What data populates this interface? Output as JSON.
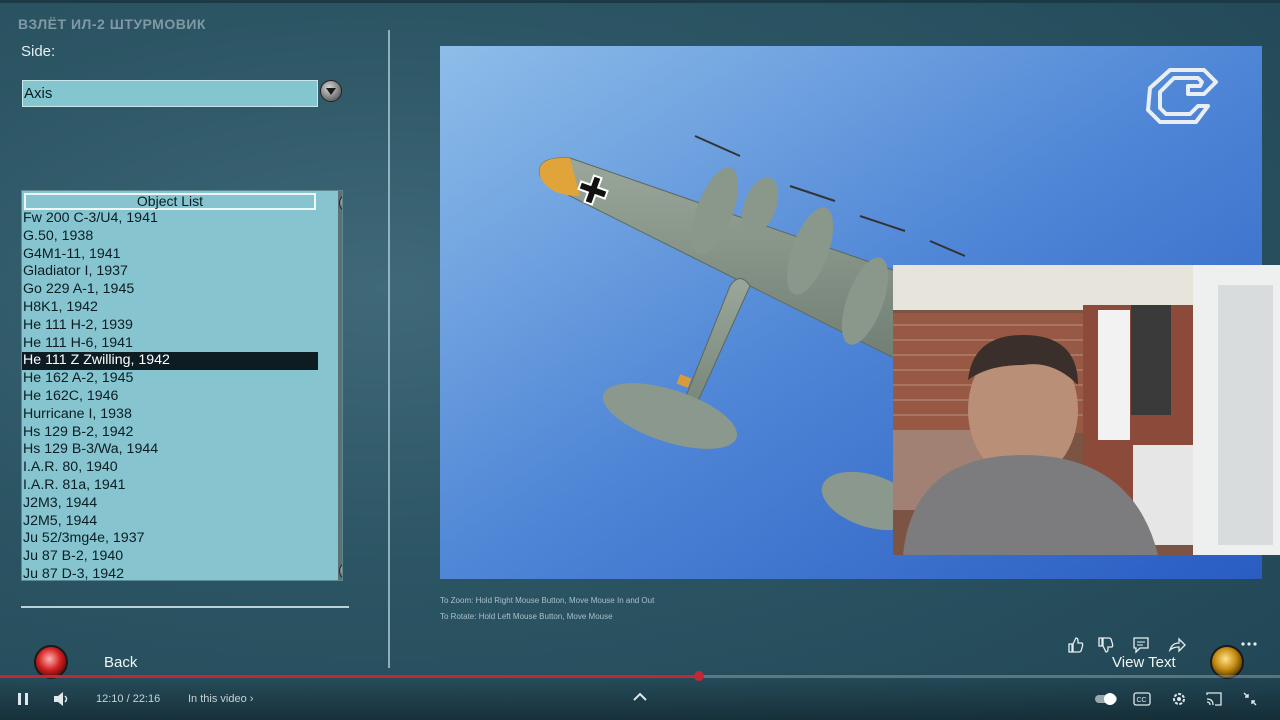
{
  "window": {
    "title": "ВЗЛЁТ ИЛ-2 ШТУРМОВИК"
  },
  "side": {
    "label": "Side:",
    "selected": "Axis"
  },
  "object_list": {
    "header": "Object List",
    "items": [
      "Fw 200 C-3/U4, 1941",
      "G.50, 1938",
      "G4M1-11, 1941",
      "Gladiator I, 1937",
      "Go 229 A-1, 1945",
      "H8K1, 1942",
      "He 111 H-2, 1939",
      "He 111 H-6, 1941",
      "He 111 Z Zwilling, 1942",
      "He 162 A-2, 1945",
      "He 162C, 1946",
      "Hurricane I, 1938",
      "Hs 129 B-2, 1942",
      "Hs 129 B-3/Wa, 1944",
      "I.A.R. 80, 1940",
      "I.A.R. 81a, 1941",
      "J2M3, 1944",
      "J2M5, 1944",
      "Ju 52/3mg4e, 1937",
      "Ju 87 B-2, 1940",
      "Ju 87 D-3, 1942"
    ],
    "selected_index": 8,
    "scroll_position": 0.48
  },
  "viewer": {
    "help_zoom": "To Zoom: Hold Right Mouse Button, Move Mouse In and Out",
    "help_rotate": "To Rotate: Hold Left Mouse Button, Move Mouse"
  },
  "buttons": {
    "back": "Back",
    "view_text": "View Text"
  },
  "player": {
    "time": "12:10 / 22:16",
    "chapters": "In this video",
    "progress": 0.546,
    "colors": {
      "progress": "#c0283a"
    }
  },
  "icons": {
    "pause": "pause-icon",
    "volume": "volume-icon",
    "expand": "chevron-up-icon",
    "like": "thumbs-up-icon",
    "dislike": "thumbs-down-icon",
    "comment": "comment-icon",
    "share": "share-icon",
    "more": "more-icon",
    "autoplay": "toggle-icon",
    "captions": "captions-icon",
    "settings": "gear-icon",
    "cast": "cast-icon",
    "collapse": "collapse-icon"
  }
}
